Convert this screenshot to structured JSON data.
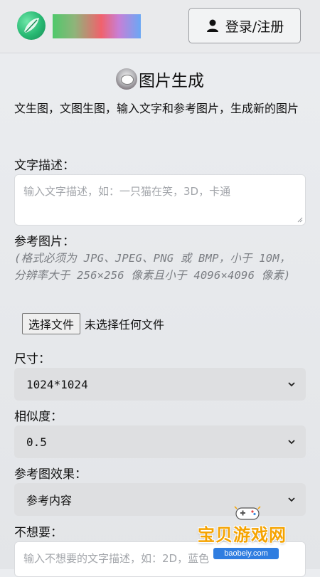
{
  "header": {
    "login_label": "登录/注册"
  },
  "page": {
    "title": "图片生成",
    "description": "文生图，文图生图，输入文字和参考图片，生成新的图片"
  },
  "form": {
    "text_label": "文字描述：",
    "text_placeholder": "输入文字描述，如：一只猫在笑，3D，卡通",
    "ref_label": "参考图片：",
    "ref_hint": "(格式必须为 JPG、JPEG、PNG 或 BMP，小于 10M，分辨率大于 256×256 像素且小于 4096×4096 像素)",
    "file_button": "选择文件",
    "file_status": "未选择任何文件",
    "size_label": "尺寸：",
    "size_value": "1024*1024",
    "similarity_label": "相似度：",
    "similarity_value": "0.5",
    "effect_label": "参考图效果：",
    "effect_value": "参考内容",
    "negative_label": "不想要：",
    "negative_placeholder": "输入不想要的文字描述，如：2D，蓝色"
  },
  "watermark": {
    "text": "宝贝游戏网",
    "url": "baobeiy.com"
  },
  "colors": {
    "watermark_orange": "#f5a300",
    "watermark_blue": "#2f7de0",
    "logo_green": "#27b872"
  },
  "icons": {
    "logo": "leaf-logo-icon",
    "login": "user-icon",
    "select": "chevron-down-icon",
    "watermark": "gamepad-icon"
  }
}
